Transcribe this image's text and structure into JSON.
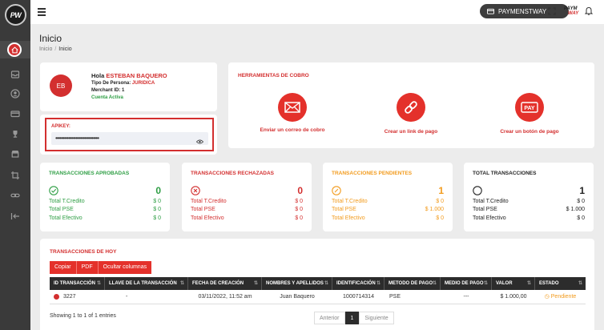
{
  "app": {
    "logo_text": "PW"
  },
  "topbar": {
    "payment_label": "PAYMENSTWAY",
    "brand_mini_top": "PAYM",
    "brand_mini_bottom": "WAY"
  },
  "page": {
    "title": "Inicio",
    "breadcrumb": [
      "Inicio",
      "Inicio"
    ]
  },
  "profile": {
    "initials": "EB",
    "greeting": "Hola",
    "name": "ESTEBAN BAQUERO",
    "person_type_label": "Tipo De Persona:",
    "person_type": "JURIDICA",
    "merchant_label": "Merchant ID:",
    "merchant_id": "1",
    "status": "Cuenta Activa"
  },
  "apikey": {
    "label": "APIKEY:",
    "value": "••••••••••••••••••••••••••••••"
  },
  "tools": {
    "title": "HERRAMIENTAS DE COBRO",
    "items": [
      {
        "label": "Enviar un correo de cobro",
        "icon": "envelope-icon"
      },
      {
        "label": "Crear un link de pago",
        "icon": "link-icon"
      },
      {
        "label": "Crear un botón de pago",
        "icon": "pay-button-icon"
      }
    ]
  },
  "stats": [
    {
      "title": "TRANSACCIONES APROBADAS",
      "count": "0",
      "color": "#2e9e44",
      "icon": "check-circle-icon",
      "rows": [
        {
          "label": "Total T.Credito",
          "value": "$ 0"
        },
        {
          "label": "Total PSE",
          "value": "$ 0"
        },
        {
          "label": "Total Efectivo",
          "value": "$ 0"
        }
      ]
    },
    {
      "title": "TRANSACCIONES RECHAZADAS",
      "count": "0",
      "color": "#d32f2f",
      "icon": "x-circle-icon",
      "rows": [
        {
          "label": "Total T.Credito",
          "value": "$ 0"
        },
        {
          "label": "Total PSE",
          "value": "$ 0"
        },
        {
          "label": "Total Efectivo",
          "value": "$ 0"
        }
      ]
    },
    {
      "title": "TRANSACCIONES PENDIENTES",
      "count": "1",
      "color": "#f29b1d",
      "icon": "pending-circle-icon",
      "rows": [
        {
          "label": "Total T.Credito",
          "value": "$ 0"
        },
        {
          "label": "Total PSE",
          "value": "$ 1.000"
        },
        {
          "label": "Total Efectivo",
          "value": "$ 0"
        }
      ]
    },
    {
      "title": "TOTAL TRANSACCIONES",
      "count": "1",
      "color": "#222222",
      "icon": "circle-icon",
      "rows": [
        {
          "label": "Total T.Credito",
          "value": "$ 0"
        },
        {
          "label": "Total PSE",
          "value": "$ 1.000"
        },
        {
          "label": "Total Efectivo",
          "value": "$ 0"
        }
      ]
    }
  ],
  "today": {
    "title": "TRANSACCIONES DE HOY",
    "buttons": [
      "Copiar",
      "PDF",
      "Ocultar columnas"
    ],
    "columns": [
      "ID TRANSACCIÓN",
      "LLAVE DE LA TRANSACCIÓN",
      "FECHA DE CREACIÓN",
      "NOMBRES Y APELLIDOS",
      "IDENTIFICACIÓN",
      "METODO DE PAGO",
      "MEDIO DE PAGO",
      "VALOR",
      "ESTADO"
    ],
    "rows": [
      [
        "3227",
        "-",
        "03/11/2022, 11:52 am",
        "Juan Baquero",
        "1000714314",
        "PSE",
        "---",
        "$ 1.000,00",
        "Pendiente"
      ]
    ],
    "showing": "Showing 1 to 1 of 1 entries",
    "pager": {
      "prev": "Anterior",
      "page": "1",
      "next": "Siguiente"
    }
  }
}
